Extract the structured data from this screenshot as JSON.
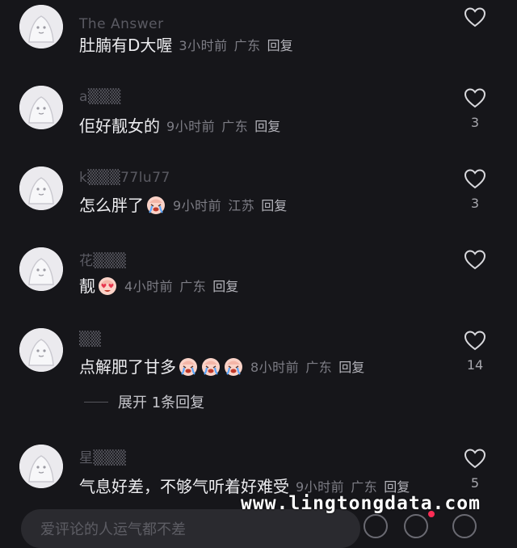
{
  "comments": [
    {
      "username": "The Answer",
      "text": "肚腩有D大喔",
      "emojis": [],
      "time": "3小时前",
      "location": "广东",
      "reply_label": "回复",
      "likes": ""
    },
    {
      "username": "a▒▒▒",
      "text": "佢好靓女的",
      "emojis": [],
      "time": "9小时前",
      "location": "广东",
      "reply_label": "回复",
      "likes": "3"
    },
    {
      "username": "k▒▒▒77lu77",
      "text": "怎么胖了",
      "emojis": [
        "crying-face"
      ],
      "time": "9小时前",
      "location": "江苏",
      "reply_label": "回复",
      "likes": "3"
    },
    {
      "username": "花▒▒▒",
      "text": "靓",
      "emojis": [
        "heart-eyes-face"
      ],
      "time": "4小时前",
      "location": "广东",
      "reply_label": "回复",
      "likes": ""
    },
    {
      "username": "▒▒",
      "text": "点解肥了甘多",
      "emojis": [
        "crying-face",
        "crying-face",
        "crying-face"
      ],
      "time": "8小时前",
      "location": "广东",
      "reply_label": "回复",
      "likes": "14"
    },
    {
      "username": "星▒▒▒",
      "text": "气息好差，不够气听着好难受",
      "emojis": [],
      "time": "9小时前",
      "location": "广东",
      "reply_label": "回复",
      "likes": "5"
    }
  ],
  "expand_replies_label": "展开 1条回复",
  "comment_input_placeholder": "爱评论的人运气都不差",
  "watermark": "www.lingtongdata.com",
  "colors": {
    "background": "#16161a",
    "text_primary": "#ececef",
    "text_meta": "#7d7d85",
    "notification_dot": "#ff2d55"
  }
}
